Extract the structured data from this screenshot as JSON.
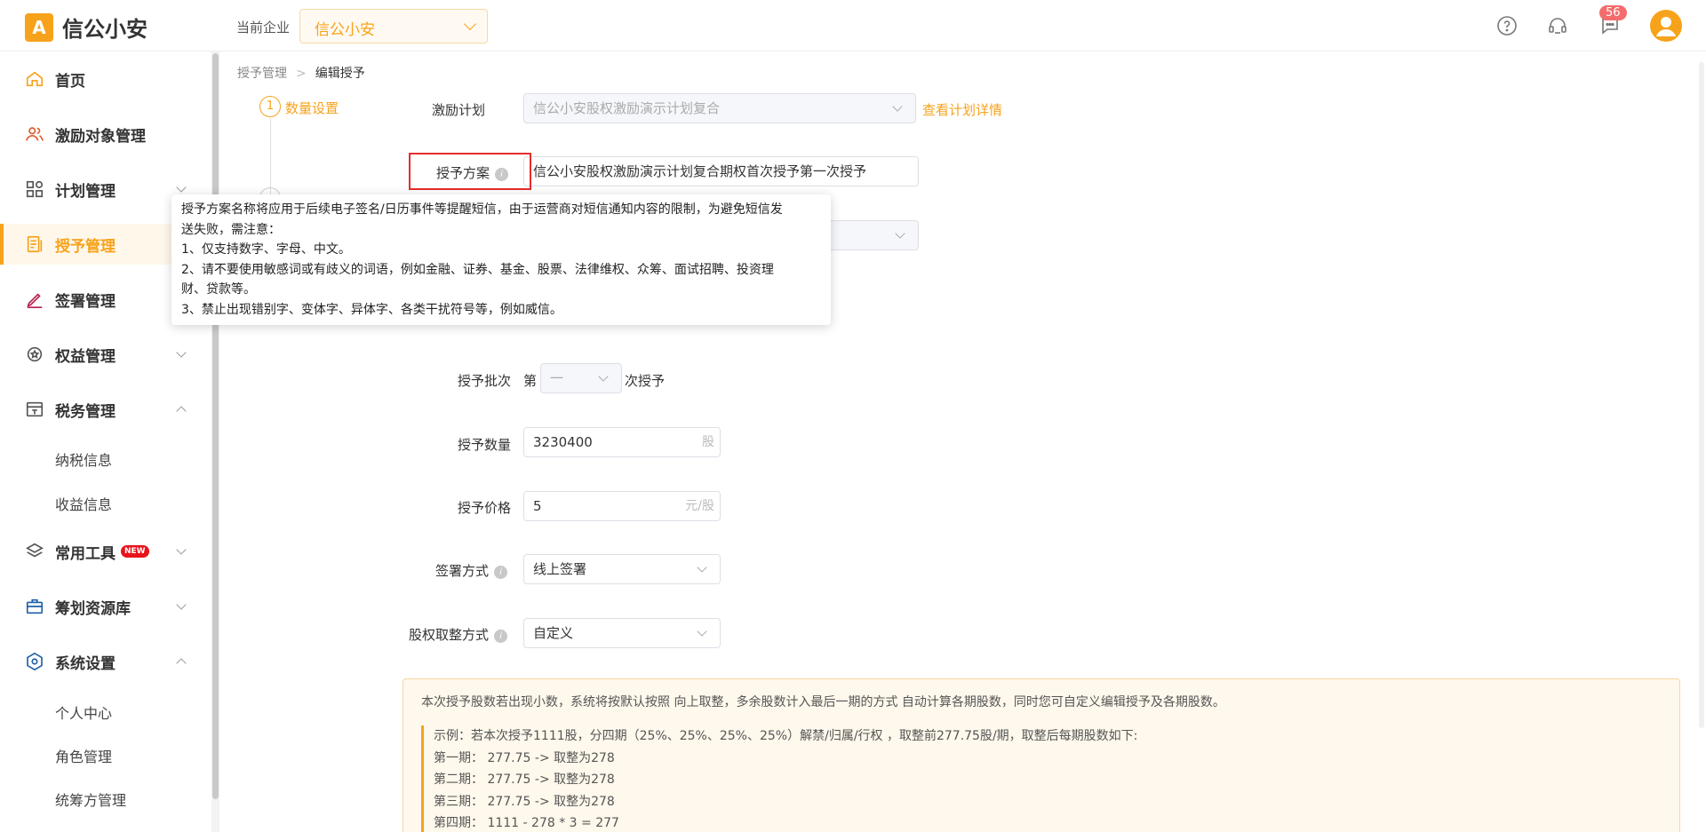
{
  "header": {
    "logo_mark": "A",
    "logo_text": "信公小安",
    "enterprise_label": "当前企业",
    "enterprise_value": "信公小安",
    "message_count": "56",
    "icons": [
      "help-icon",
      "headset-icon",
      "message-icon",
      "user-avatar-icon"
    ]
  },
  "sidebar": {
    "items": [
      {
        "label": "首页",
        "icon": "home-icon"
      },
      {
        "label": "激励对象管理",
        "icon": "people-icon"
      },
      {
        "label": "计划管理",
        "icon": "grid-icon"
      },
      {
        "label": "授予管理",
        "icon": "document-icon"
      },
      {
        "label": "签署管理",
        "icon": "pen-icon"
      },
      {
        "label": "权益管理",
        "icon": "medal-icon"
      },
      {
        "label": "税务管理",
        "icon": "tax-icon"
      },
      {
        "label": "常用工具",
        "icon": "layers-icon"
      },
      {
        "label": "筹划资源库",
        "icon": "toolbox-icon"
      },
      {
        "label": "系统设置",
        "icon": "gear-icon"
      }
    ],
    "tax_sub": [
      "纳税信息",
      "收益信息"
    ],
    "settings_sub": [
      "个人中心",
      "角色管理",
      "统筹方管理"
    ],
    "new_badge": "NEW"
  },
  "breadcrumb": {
    "parent": "授予管理",
    "current": "编辑授予"
  },
  "steps": {
    "step1_num": "1",
    "step1_label": "数量设置"
  },
  "form": {
    "plan_label": "激励计划",
    "plan_value": "信公小安股权激励演示计划复合",
    "plan_link": "查看计划详情",
    "scheme_label": "授予方案",
    "scheme_value": "信公小安股权激励演示计划复合期权首次授予第一次授予",
    "batch_label": "授予批次",
    "batch_prefix": "第",
    "batch_value": "一",
    "batch_suffix": "次授予",
    "qty_label": "授予数量",
    "qty_value": "3230400",
    "qty_unit": "股",
    "price_label": "授予价格",
    "price_value": "5",
    "price_unit": "元/股",
    "sign_label": "签署方式",
    "sign_value": "线上签署",
    "round_label": "股权取整方式",
    "round_value": "自定义"
  },
  "tooltip": {
    "lines": [
      "授予方案名称将应用于后续电子签名/日历事件等提醒短信，由于运营商对短信通知内容的限制，为避免短信发",
      "送失败，需注意：",
      "1、仅支持数字、字母、中文。",
      "2、请不要使用敏感词或有歧义的词语，例如金融、证券、基金、股票、法律维权、众筹、面试招聘、投资理",
      "财、贷款等。",
      "3、禁止出现错别字、变体字、异体字、各类干扰符号等，例如威信。"
    ]
  },
  "notice": {
    "top": "本次授予股数若出现小数，系统将按默认按照 向上取整，多余股数计入最后一期的方式 自动计算各期股数，同时您可自定义编辑授予及各期股数。",
    "example": [
      "示例：若本次授予1111股，分四期（25%、25%、25%、25%）解禁/归属/行权 ，取整前277.75股/期，取整后每期股数如下:",
      "第一期： 277.75 -> 取整为278",
      "第二期： 277.75 -> 取整为278",
      "第三期： 277.75 -> 取整为278",
      "第四期： 1111 - 278 * 3 = 277"
    ]
  },
  "colors": {
    "accent": "#f7a21b",
    "highlight_red": "#e52d2d"
  }
}
